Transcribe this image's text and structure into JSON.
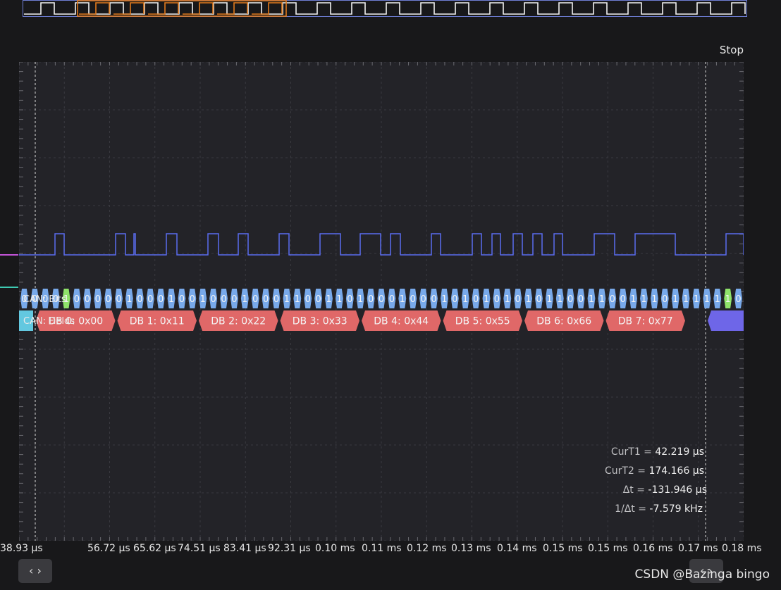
{
  "app": {
    "run_state": "Stop",
    "watermark": "CSDN @Bazinga bingo"
  },
  "decoders": {
    "bits_label": "CAN: Bits",
    "fields_label": "CAN: Fields",
    "bits": [
      "0",
      "0",
      "0",
      "0",
      "1",
      "0",
      "0",
      "0",
      "0",
      "0",
      "1",
      "0",
      "0",
      "0",
      "1",
      "0",
      "0",
      "1",
      "0",
      "0",
      "0",
      "1",
      "0",
      "0",
      "0",
      "1",
      "1",
      "0",
      "0",
      "1",
      "1",
      "0",
      "1",
      "0",
      "0",
      "0",
      "1",
      "0",
      "0",
      "0",
      "1",
      "0",
      "1",
      "0",
      "1",
      "0",
      "1",
      "0",
      "1",
      "0",
      "1",
      "1",
      "0",
      "0",
      "1",
      "1",
      "0",
      "0",
      "1",
      "1",
      "1",
      "0",
      "1",
      "1",
      "1",
      "1",
      "1",
      "1",
      "0"
    ],
    "stuff_bits_index": [
      4,
      67
    ],
    "fields": [
      {
        "label": "DB 0: 0x00"
      },
      {
        "label": "DB 1: 0x11"
      },
      {
        "label": "DB 2: 0x22"
      },
      {
        "label": "DB 3: 0x33"
      },
      {
        "label": "DB 4: 0x44"
      },
      {
        "label": "DB 5: 0x55"
      },
      {
        "label": "DB 6: 0x66"
      },
      {
        "label": "DB 7: 0x77"
      }
    ]
  },
  "cursors": {
    "t1_label": "CurT1 =",
    "t1_value": "42.219 μs",
    "t2_label": "CurT2 =",
    "t2_value": "174.166 μs",
    "dt_label": "Δt =",
    "dt_value": "-131.946 μs",
    "inv_label": "1/Δt =",
    "inv_value": "-7.579 kHz"
  },
  "time_axis": {
    "ticks": [
      "38.93 μs",
      "56.72 μs",
      "65.62 μs",
      "74.51 μs",
      "83.41 μs",
      "92.31 μs",
      "0.10 ms",
      "0.11 ms",
      "0.12 ms",
      "0.13 ms",
      "0.14 ms",
      "0.15 ms",
      "0.15 ms",
      "0.16 ms",
      "0.17 ms",
      "0.18 ms"
    ]
  },
  "nav": {
    "left_button_label": "‹ ›",
    "right_button_label": "‹ ›"
  },
  "colors": {
    "signal": "#5b6cf0",
    "bits_fill": "#78a9ea",
    "stuff_fill": "#8fe36a",
    "field_fill": "#e06868",
    "sof_fill": "#63c8e0",
    "eof_fill": "#6e66e8",
    "overview_highlight": "#e27a1c",
    "marker_magenta": "#c353d8",
    "marker_teal": "#3ec9b2"
  }
}
